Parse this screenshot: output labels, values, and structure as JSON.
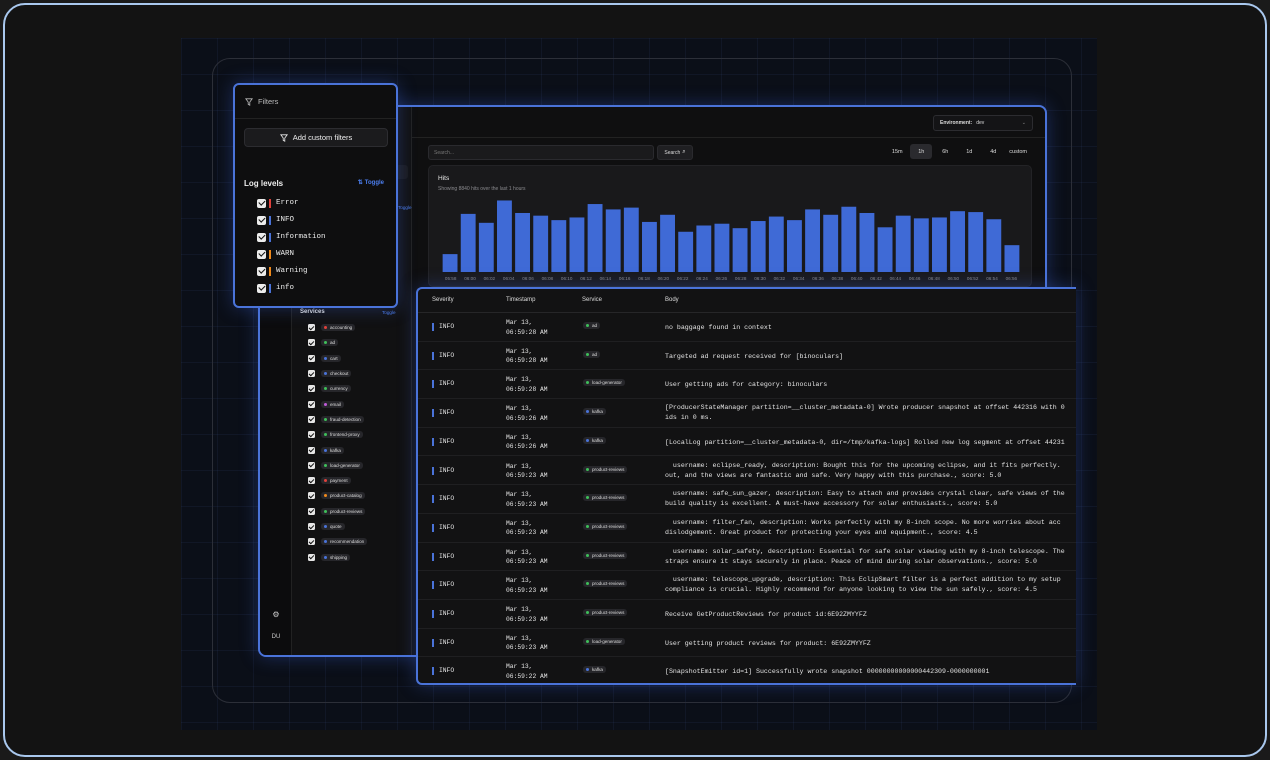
{
  "environment": {
    "label": "Environment:",
    "value": "dev"
  },
  "search": {
    "placeholder": "Search...",
    "button_label": "Search"
  },
  "time_ranges": [
    {
      "label": "15m",
      "active": false
    },
    {
      "label": "1h",
      "active": true
    },
    {
      "label": "6h",
      "active": false
    },
    {
      "label": "1d",
      "active": false
    },
    {
      "label": "4d",
      "active": false
    },
    {
      "label": "custom",
      "active": false
    }
  ],
  "filters": {
    "title": "Filters",
    "add_button": "Add custom filters",
    "log_levels_title": "Log levels",
    "toggle_label": "Toggle",
    "levels": [
      {
        "label": "Error",
        "color": "#e0413c"
      },
      {
        "label": "INFO",
        "color": "#4a73d9"
      },
      {
        "label": "Information",
        "color": "#4a73d9"
      },
      {
        "label": "WARN",
        "color": "#f08a1c"
      },
      {
        "label": "Warning",
        "color": "#f08a1c"
      },
      {
        "label": "info",
        "color": "#4a73d9"
      }
    ]
  },
  "sidebar": {
    "services_title": "Services",
    "toggle_label": "Toggle",
    "user_initials": "DU",
    "services": [
      {
        "name": "accounting",
        "color": "#e0413c"
      },
      {
        "name": "ad",
        "color": "#3fbf5a"
      },
      {
        "name": "cart",
        "color": "#4a73d9"
      },
      {
        "name": "checkout",
        "color": "#4a73d9"
      },
      {
        "name": "currency",
        "color": "#3fbf5a"
      },
      {
        "name": "email",
        "color": "#c05ad8"
      },
      {
        "name": "fraud-detection",
        "color": "#3fbf5a"
      },
      {
        "name": "frontend-proxy",
        "color": "#3fbf5a"
      },
      {
        "name": "kafka",
        "color": "#4a73d9"
      },
      {
        "name": "load-generator",
        "color": "#3fbf5a"
      },
      {
        "name": "payment",
        "color": "#e0413c"
      },
      {
        "name": "product-catalog",
        "color": "#f08a1c"
      },
      {
        "name": "product-reviews",
        "color": "#3fbf5a"
      },
      {
        "name": "quote",
        "color": "#4a73d9"
      },
      {
        "name": "recommendation",
        "color": "#4a73d9"
      },
      {
        "name": "shipping",
        "color": "#4a73d9"
      }
    ]
  },
  "hits": {
    "title": "Hits",
    "subtitle": "Showing 8840 hits over the last 1 hours"
  },
  "chart_data": {
    "type": "bar",
    "categories": [
      "05:58",
      "06:00",
      "06:02",
      "06:04",
      "06:06",
      "06:08",
      "06:10",
      "06:12",
      "06:14",
      "06:16",
      "06:18",
      "06:20",
      "06:22",
      "06:24",
      "06:26",
      "06:28",
      "06:30",
      "06:32",
      "06:34",
      "06:36",
      "06:38",
      "06:40",
      "06:42",
      "06:44",
      "06:46",
      "06:48",
      "06:50",
      "06:52",
      "06:54",
      "06:56"
    ],
    "values": [
      20,
      65,
      55,
      80,
      66,
      63,
      58,
      61,
      76,
      70,
      72,
      56,
      64,
      45,
      52,
      54,
      49,
      57,
      62,
      58,
      70,
      64,
      73,
      66,
      50,
      63,
      60,
      61,
      68,
      67,
      59,
      30
    ],
    "bar_color": "#3f6ad6"
  },
  "table": {
    "headers": {
      "severity": "Severity",
      "timestamp": "Timestamp",
      "service": "Service",
      "body": "Body"
    },
    "rows": [
      {
        "severity": "INFO",
        "date": "Mar 13,",
        "time": "06:59:28 AM",
        "service": "ad",
        "dot": "#3fbf5a",
        "body": "no baggage found in context"
      },
      {
        "severity": "INFO",
        "date": "Mar 13,",
        "time": "06:59:28 AM",
        "service": "ad",
        "dot": "#3fbf5a",
        "body": "Targeted ad request received for [binoculars]"
      },
      {
        "severity": "INFO",
        "date": "Mar 13,",
        "time": "06:59:28 AM",
        "service": "load-generator",
        "dot": "#3fbf5a",
        "body": "User getting ads for category: binoculars"
      },
      {
        "severity": "INFO",
        "date": "Mar 13,",
        "time": "06:59:26 AM",
        "service": "kafka",
        "dot": "#4a73d9",
        "body": "[ProducerStateManager partition=__cluster_metadata-0] Wrote producer snapshot at offset 442316 with 0\nids in 0 ms."
      },
      {
        "severity": "INFO",
        "date": "Mar 13,",
        "time": "06:59:26 AM",
        "service": "kafka",
        "dot": "#4a73d9",
        "body": "[LocalLog partition=__cluster_metadata-0, dir=/tmp/kafka-logs] Rolled new log segment at offset 44231"
      },
      {
        "severity": "INFO",
        "date": "Mar 13,",
        "time": "06:59:23 AM",
        "service": "product-reviews",
        "dot": "#3fbf5a",
        "body": "  username: eclipse_ready, description: Bought this for the upcoming eclipse, and it fits perfectly.\nout, and the views are fantastic and safe. Very happy with this purchase., score: 5.0"
      },
      {
        "severity": "INFO",
        "date": "Mar 13,",
        "time": "06:59:23 AM",
        "service": "product-reviews",
        "dot": "#3fbf5a",
        "body": "  username: safe_sun_gazer, description: Easy to attach and provides crystal clear, safe views of the\nbuild quality is excellent. A must-have accessory for solar enthusiasts., score: 5.0"
      },
      {
        "severity": "INFO",
        "date": "Mar 13,",
        "time": "06:59:23 AM",
        "service": "product-reviews",
        "dot": "#3fbf5a",
        "body": "  username: filter_fan, description: Works perfectly with my 8-inch scope. No more worries about acc\ndislodgement. Great product for protecting your eyes and equipment., score: 4.5"
      },
      {
        "severity": "INFO",
        "date": "Mar 13,",
        "time": "06:59:23 AM",
        "service": "product-reviews",
        "dot": "#3fbf5a",
        "body": "  username: solar_safety, description: Essential for safe solar viewing with my 8-inch telescope. The\nstraps ensure it stays securely in place. Peace of mind during solar observations., score: 5.0"
      },
      {
        "severity": "INFO",
        "date": "Mar 13,",
        "time": "06:59:23 AM",
        "service": "product-reviews",
        "dot": "#3fbf5a",
        "body": "  username: telescope_upgrade, description: This EclipSmart filter is a perfect addition to my setup\ncompliance is crucial. Highly recommend for anyone looking to view the sun safely., score: 4.5"
      },
      {
        "severity": "INFO",
        "date": "Mar 13,",
        "time": "06:59:23 AM",
        "service": "product-reviews",
        "dot": "#3fbf5a",
        "body": "Receive GetProductReviews for product id:6E92ZMYYFZ"
      },
      {
        "severity": "INFO",
        "date": "Mar 13,",
        "time": "06:59:23 AM",
        "service": "load-generator",
        "dot": "#3fbf5a",
        "body": "User getting product reviews for product: 6E92ZMYYFZ"
      },
      {
        "severity": "INFO",
        "date": "Mar 13,",
        "time": "06:59:22 AM",
        "service": "kafka",
        "dot": "#4a73d9",
        "body": "[SnapshotEmitter id=1] Successfully wrote snapshot 00000000000000442309-0000000001"
      }
    ]
  }
}
